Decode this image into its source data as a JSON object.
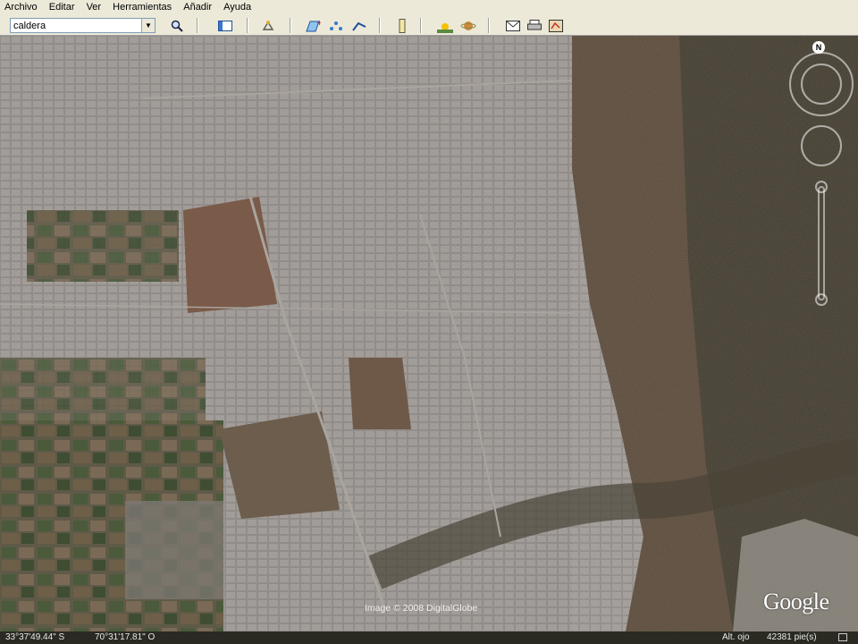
{
  "menu": [
    "Archivo",
    "Editar",
    "Ver",
    "Herramientas",
    "Añadir",
    "Ayuda"
  ],
  "search": {
    "value": "caldera"
  },
  "toolbar_icons": [
    "search-icon",
    "sidebar-toggle-icon",
    "hand-tour-icon",
    "placemark-icon",
    "polygon-icon",
    "path-icon",
    "ruler-icon",
    "sun-icon",
    "planet-icon",
    "email-icon",
    "print-icon",
    "map-view-icon"
  ],
  "map": {
    "credit": "Image © 2008 DigitalGlobe",
    "logo": "Google",
    "compass_north": "N"
  },
  "status": {
    "lat": "33°37'49.44\" S",
    "lon": "70°31'17.81\" O",
    "alt_label": "Alt. ojo",
    "alt_value": "42381 pie(s)"
  }
}
